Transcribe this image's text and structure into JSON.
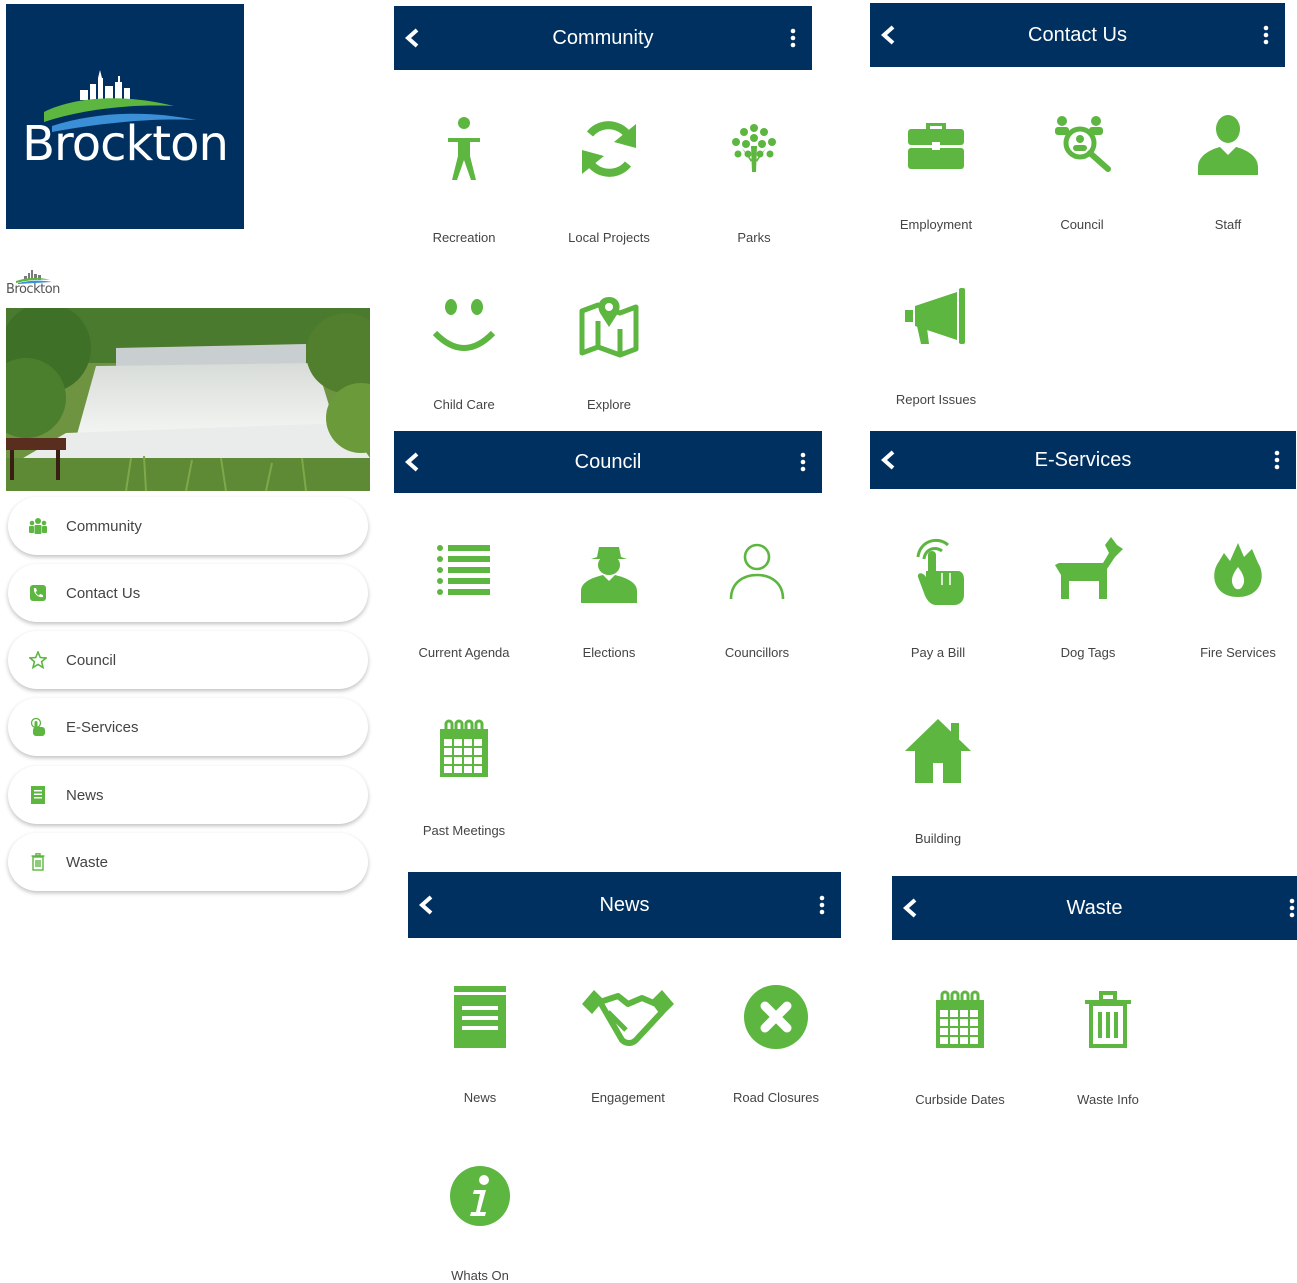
{
  "brand": {
    "logo_text": "Brockton",
    "small_logo_text": "Brockton"
  },
  "colors": {
    "navy": "#00305f",
    "green": "#5cb63f"
  },
  "home_menu": [
    {
      "label": "Community",
      "icon": "community-icon"
    },
    {
      "label": "Contact Us",
      "icon": "phone-icon"
    },
    {
      "label": "Council",
      "icon": "star-icon"
    },
    {
      "label": "E-Services",
      "icon": "touch-icon"
    },
    {
      "label": "News",
      "icon": "news-icon"
    },
    {
      "label": "Waste",
      "icon": "trash-icon"
    }
  ],
  "screens": {
    "community": {
      "title": "Community",
      "items": [
        "Recreation",
        "Local Projects",
        "Parks",
        "Child Care",
        "Explore"
      ]
    },
    "contact": {
      "title": "Contact Us",
      "items": [
        "Employment",
        "Council",
        "Staff",
        "Report Issues"
      ]
    },
    "council": {
      "title": "Council",
      "items": [
        "Current Agenda",
        "Elections",
        "Councillors",
        "Past Meetings"
      ]
    },
    "eservices": {
      "title": "E-Services",
      "items": [
        "Pay a Bill",
        "Dog Tags",
        "Fire Services",
        "Building"
      ]
    },
    "news": {
      "title": "News",
      "items": [
        "News",
        "Engagement",
        "Road Closures",
        "Whats On"
      ]
    },
    "waste": {
      "title": "Waste",
      "items": [
        "Curbside Dates",
        "Waste Info"
      ]
    }
  }
}
